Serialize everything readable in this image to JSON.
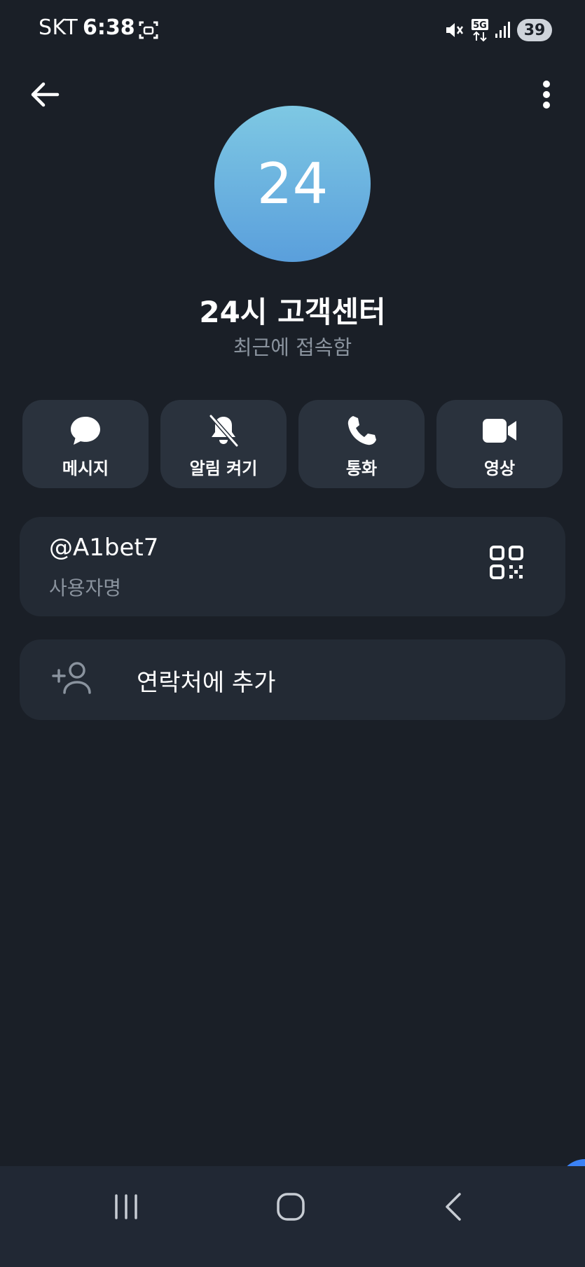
{
  "status_bar": {
    "carrier": "SKT",
    "time": "6:38",
    "network": "5G",
    "battery": "39",
    "icons": [
      "screenshot-icon",
      "mute-vibrate-icon",
      "signal-icon"
    ]
  },
  "top_bar": {
    "back_icon": "arrow-left-icon",
    "menu_icon": "more-vertical-icon"
  },
  "profile": {
    "avatar_text": "24",
    "avatar_gradient": [
      "#7ec8e3",
      "#5a9fdc"
    ],
    "name": "24시 고객센터",
    "status": "최근에 접속함"
  },
  "actions": [
    {
      "label": "메시지",
      "icon": "chat-bubble-icon"
    },
    {
      "label": "알림 켜기",
      "icon": "bell-off-icon"
    },
    {
      "label": "통화",
      "icon": "phone-icon"
    },
    {
      "label": "영상",
      "icon": "video-camera-icon"
    }
  ],
  "username_card": {
    "value": "@A1bet7",
    "caption": "사용자명",
    "icon": "qr-code-icon"
  },
  "add_contact": {
    "label": "연락처에 추가",
    "icon": "add-person-icon"
  },
  "nav_bar": {
    "icons": [
      "recent-apps-icon",
      "home-icon",
      "back-nav-icon"
    ]
  },
  "colors": {
    "background": "#1a1f27",
    "card": "#232a34",
    "action_button": "#2a323d",
    "secondary_text": "#8a939e",
    "accent": "#3b82f6"
  }
}
